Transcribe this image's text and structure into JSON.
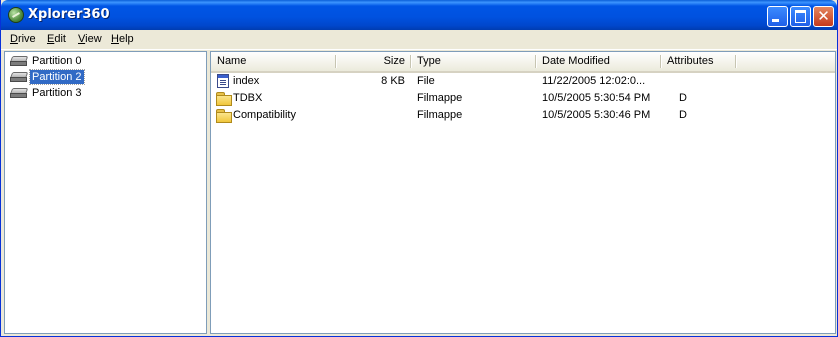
{
  "window": {
    "title": "Xplorer360"
  },
  "menu": [
    {
      "key": "D",
      "rest": "rive"
    },
    {
      "key": "E",
      "rest": "dit"
    },
    {
      "key": "V",
      "rest": "iew"
    },
    {
      "key": "H",
      "rest": "elp"
    }
  ],
  "tree": {
    "items": [
      {
        "label": "Partition 0",
        "icon": "hard-drive-icon",
        "selected": false
      },
      {
        "label": "Partition 2",
        "icon": "hard-drive-icon",
        "selected": true
      },
      {
        "label": "Partition 3",
        "icon": "hard-drive-icon",
        "selected": false
      }
    ]
  },
  "list": {
    "columns": [
      "Name",
      "Size",
      "Type",
      "Date Modified",
      "Attributes"
    ],
    "rows": [
      {
        "icon": "file-icon",
        "name": "index",
        "size": "8 KB",
        "type": "File",
        "modified": "11/22/2005 12:02:0...",
        "attributes": ""
      },
      {
        "icon": "folder-icon",
        "name": "TDBX",
        "size": "",
        "type": "Filmappe",
        "modified": "10/5/2005 5:30:54 PM",
        "attributes": "D"
      },
      {
        "icon": "folder-icon",
        "name": "Compatibility",
        "size": "",
        "type": "Filmappe",
        "modified": "10/5/2005 5:30:46 PM",
        "attributes": "D"
      }
    ]
  },
  "colors": {
    "titlebar": "#0055e5",
    "selection": "#316ac5",
    "window_bg": "#ece9d8"
  }
}
